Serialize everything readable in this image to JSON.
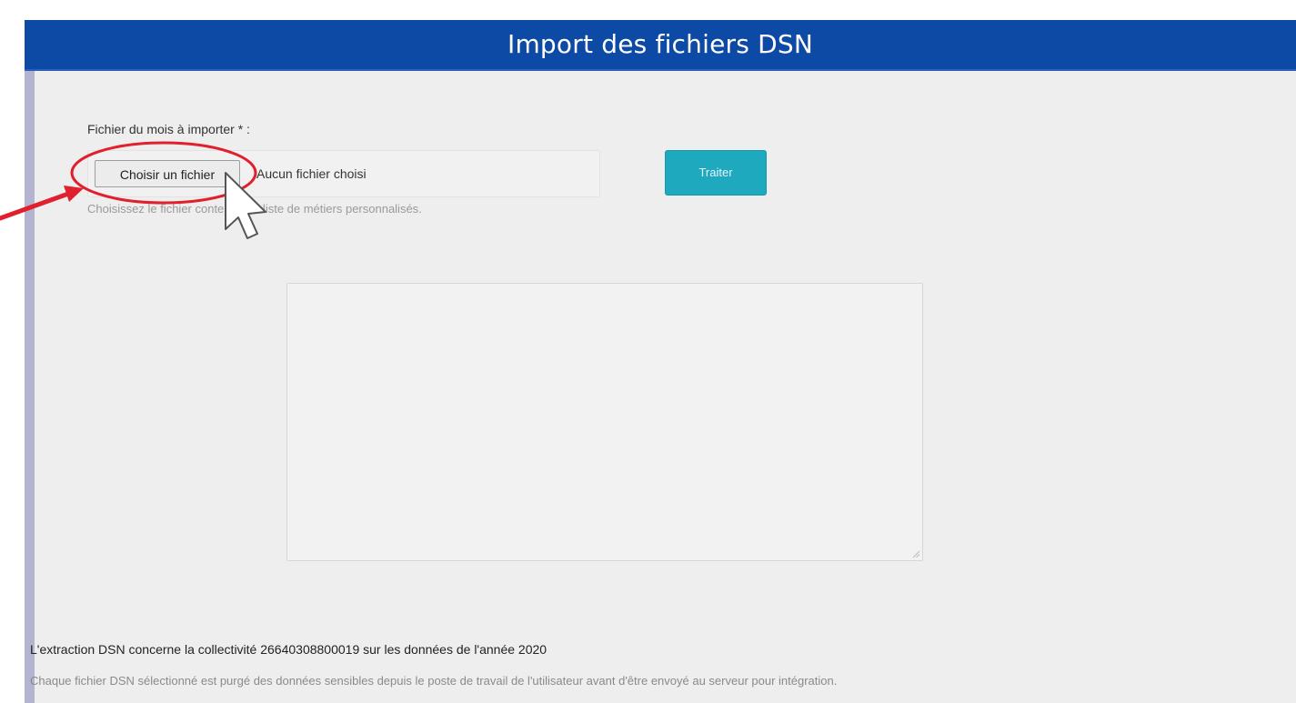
{
  "header": {
    "title": "Import des fichiers DSN"
  },
  "form": {
    "file_label": "Fichier du mois à importer * :",
    "choose_file_label": "Choisir un fichier",
    "no_file_text": "Aucun fichier choisi",
    "helper_text": "Choisissez le fichier contenant la liste de métiers personnalisés.",
    "process_label": "Traiter"
  },
  "result": {
    "value": ""
  },
  "info": {
    "line1": "L'extraction DSN concerne la collectivité 26640308800019 sur les données de l'année 2020",
    "line2": "Chaque fichier DSN sélectionné est purgé des données sensibles depuis le poste de travail de l'utilisateur avant d'être envoyé au serveur pour intégration."
  },
  "annotation": {
    "color": "#e0202c",
    "cursor_icon": "mouse-pointer-icon"
  },
  "colors": {
    "header_bg": "#0d4aa6",
    "panel_bg": "#eeeeee",
    "process_button": "#1fa9bf",
    "left_rail": "#b4b3d0"
  }
}
